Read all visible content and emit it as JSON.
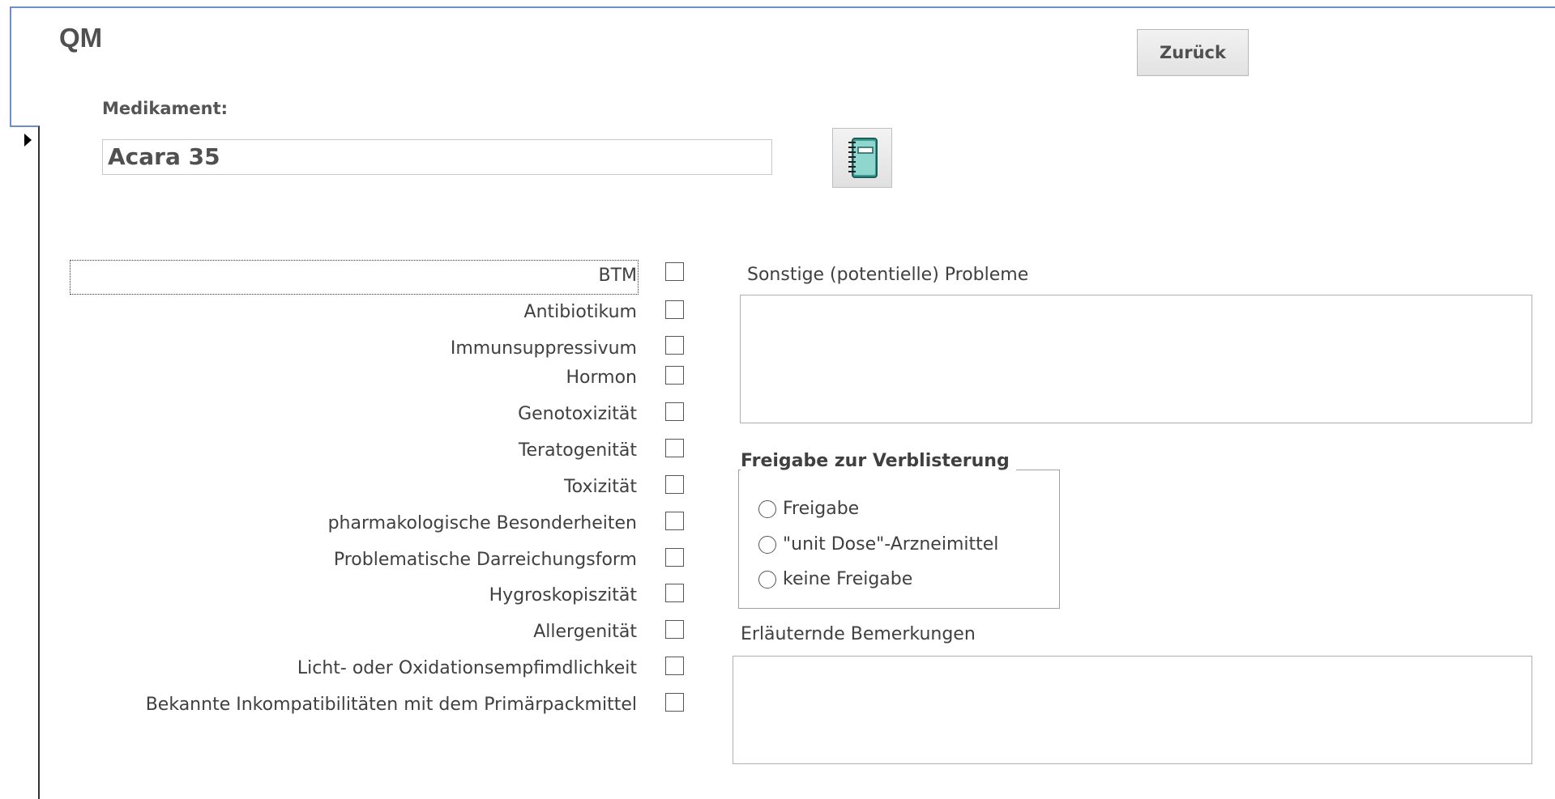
{
  "form": {
    "title": "QM",
    "back_label": "Zurück"
  },
  "medication": {
    "label": "Medikament:",
    "value": "Acara 35"
  },
  "icons": {
    "notebook": "notebook-icon",
    "record_selector": "record-selector-arrow-icon"
  },
  "checkboxes": [
    {
      "label": "BTM",
      "checked": false
    },
    {
      "label": "Antibiotikum",
      "checked": false
    },
    {
      "label": "Immunsuppressivum",
      "checked": false
    },
    {
      "label": "Hormon",
      "checked": false
    },
    {
      "label": "Genotoxizität",
      "checked": false
    },
    {
      "label": "Teratogenität",
      "checked": false
    },
    {
      "label": "Toxizität",
      "checked": false
    },
    {
      "label": "pharmakologische Besonderheiten",
      "checked": false
    },
    {
      "label": "Problematische Darreichungsform",
      "checked": false
    },
    {
      "label": "Hygroskopiszität",
      "checked": false
    },
    {
      "label": "Allergenität",
      "checked": false
    },
    {
      "label": "Licht- oder Oxidationsempfimdlichkeit",
      "checked": false
    },
    {
      "label": "Bekannte Inkompatibilitäten mit dem Primärpackmittel",
      "checked": false
    }
  ],
  "problems": {
    "label": "Sonstige (potentielle) Probleme",
    "value": ""
  },
  "release": {
    "title": "Freigabe zur Verblisterung",
    "options": [
      "Freigabe",
      "\"unit Dose\"-Arzneimittel",
      "keine Freigabe"
    ],
    "selected": null
  },
  "remarks": {
    "label": "Erläuternde Bemerkungen",
    "value": ""
  },
  "colors": {
    "frame_border": "#6f8ec8",
    "text": "#404040"
  }
}
